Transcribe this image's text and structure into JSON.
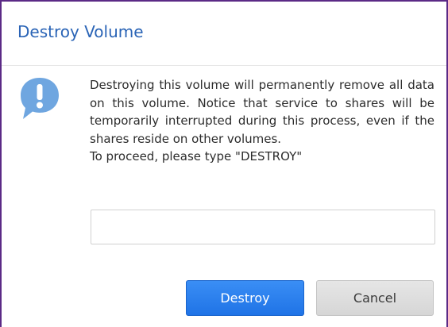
{
  "dialog": {
    "title": "Destroy Volume",
    "message_paragraph": "Destroying this volume will permanently remove all data on this volume. Notice that service to shares will be temporarily interrupted during this process, even if the shares reside on other volumes.",
    "message_instruction": "To proceed, please type \"DESTROY\"",
    "input": {
      "value": "",
      "placeholder": ""
    },
    "buttons": {
      "destroy_label": "Destroy",
      "cancel_label": "Cancel"
    },
    "icon": "info-bubble-icon"
  },
  "colors": {
    "title": "#2a64b6",
    "icon": "#6fa6e0",
    "primary_button": "#2a7ff0",
    "secondary_button": "#dedede",
    "border": "#5b2a86"
  }
}
